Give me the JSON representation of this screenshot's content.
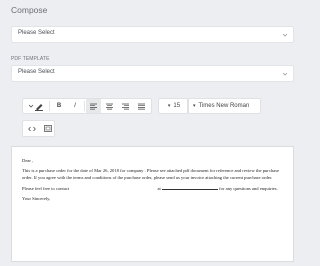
{
  "compose": {
    "title": "Compose"
  },
  "select_1": {
    "value": "Please Select",
    "icon": "chevron-down-icon"
  },
  "pdf_template": {
    "label": "PDF TEMPLATE",
    "value": "Please Select",
    "icon": "chevron-down-icon"
  },
  "toolbar": {
    "highlight_icon": "highlighter-icon",
    "bold": "B",
    "italic": "I",
    "align_left_icon": "align-left-icon",
    "align_center_icon": "align-center-icon",
    "align_right_icon": "align-right-icon",
    "align_justify_icon": "align-justify-icon",
    "font_size": "15",
    "font_family": "Times New Roman",
    "code_icon": "code-view-icon",
    "fullscreen_icon": "fullscreen-icon"
  },
  "editor": {
    "greeting": "Dear ,",
    "paragraph_1": "This is a purchase order for the date of Mar 26, 2018 for company . Please see attached pdf document for reference and review the purchase order. If you agree with the terms and conditions of the purchase order, please send us your invoice attaching the current purchase order.",
    "contact_prefix": "Please feel free to contact",
    "contact_at": "at",
    "contact_suffix": "for any questions and enquiries.",
    "closing": "Your Sincerely,"
  }
}
